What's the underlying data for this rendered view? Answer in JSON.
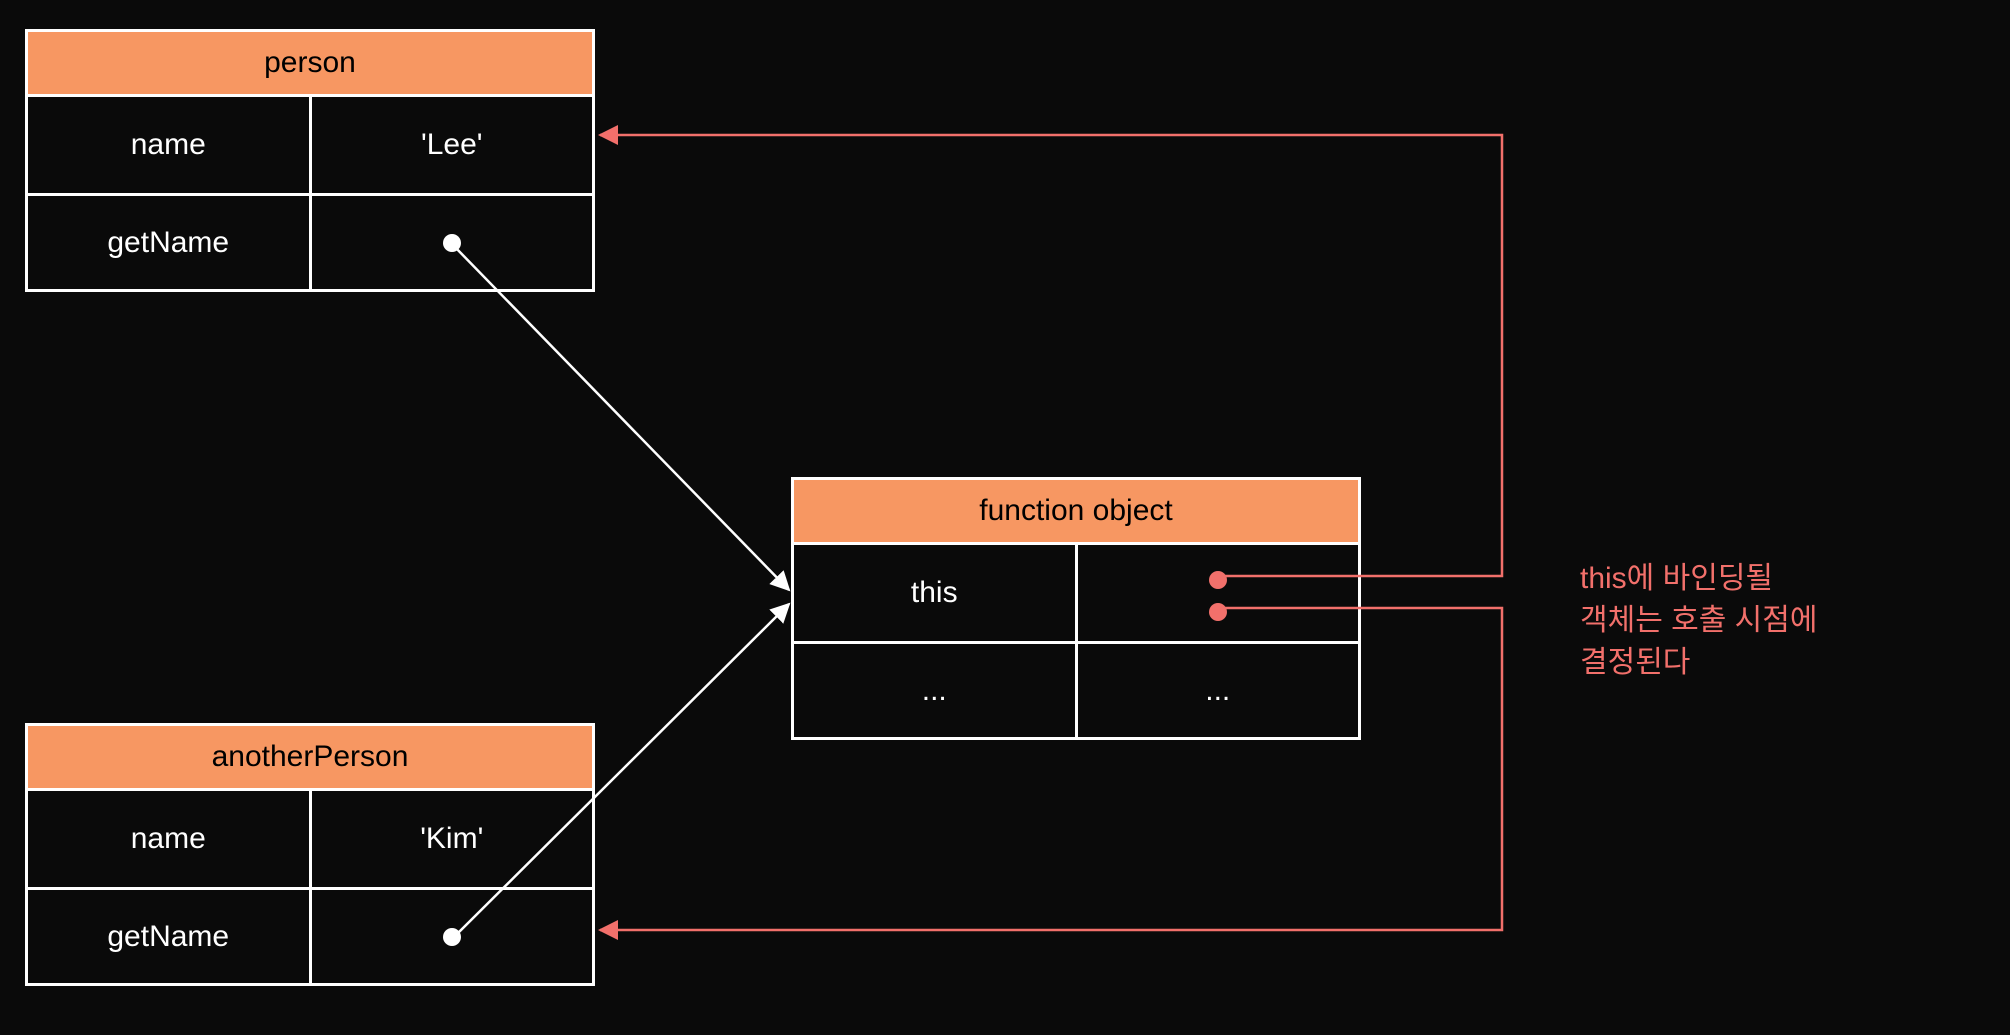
{
  "colors": {
    "bg": "#0a0a0a",
    "header": "#f79762",
    "border": "#ffffff",
    "text": "#ffffff",
    "accent": "#f2706b"
  },
  "person": {
    "title": "person",
    "rows": [
      {
        "key": "name",
        "value": "'Lee'"
      },
      {
        "key": "getName",
        "value": ""
      }
    ]
  },
  "anotherPerson": {
    "title": "anotherPerson",
    "rows": [
      {
        "key": "name",
        "value": "'Kim'"
      },
      {
        "key": "getName",
        "value": ""
      }
    ]
  },
  "functionObject": {
    "title": "function object",
    "rows": [
      {
        "key": "this",
        "value": ""
      },
      {
        "key": "...",
        "value": "..."
      }
    ]
  },
  "annotation": {
    "line1": "this에 바인딩될",
    "line2": "객체는 호출 시점에",
    "line3": "결정된다"
  }
}
